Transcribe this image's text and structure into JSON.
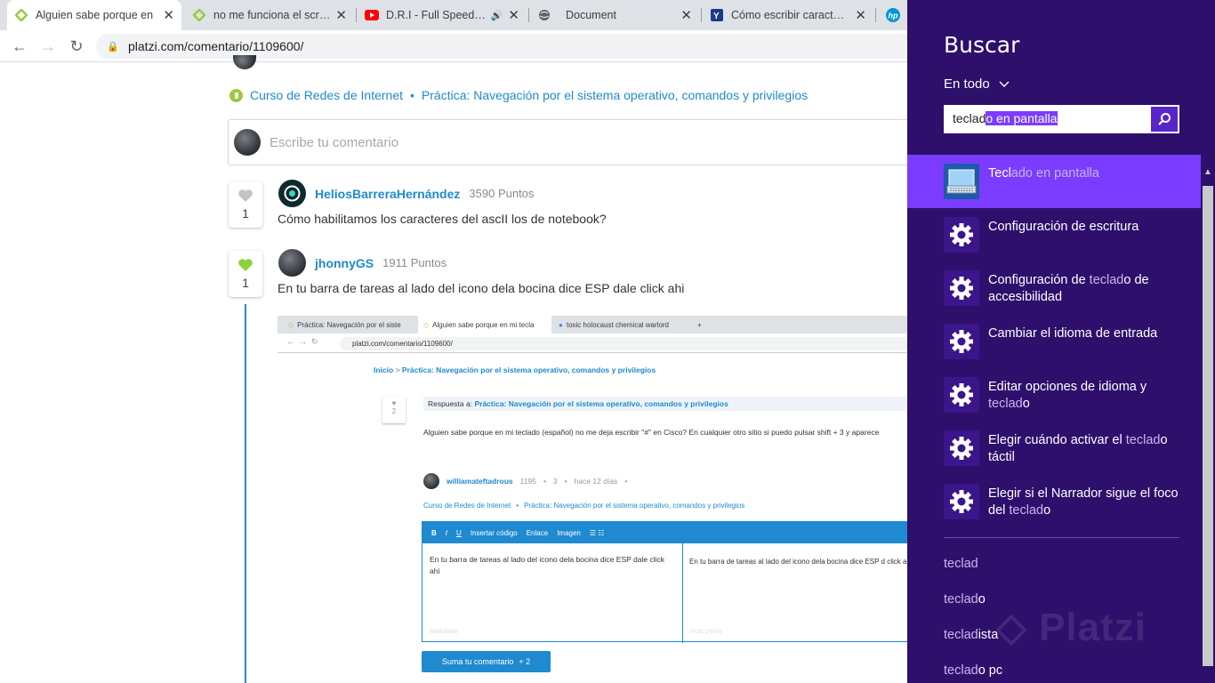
{
  "browser": {
    "tabs": [
      {
        "title": "Alguien sabe porque en",
        "favicon": "platzi"
      },
      {
        "title": "no me funciona el scritp",
        "favicon": "platzi"
      },
      {
        "title": "D.R.I - Full Speed Ah",
        "favicon": "youtube"
      },
      {
        "title": "Document",
        "favicon": "globe"
      },
      {
        "title": "Cómo escribir caracteres",
        "favicon": "yahoo"
      },
      {
        "title": "",
        "favicon": "hp"
      }
    ],
    "url": "platzi.com/comentario/1109600/"
  },
  "page": {
    "breadcrumb": {
      "course": "Curso de Redes de Internet",
      "lesson": "Práctica: Navegación por el sistema operativo, comandos y privilegios"
    },
    "comment_placeholder": "Escribe tu comentario",
    "comments": [
      {
        "user": "HeliosBarreraHernández",
        "points": "3590 Puntos",
        "likes": "1",
        "text": "Cómo habilitamos los caracteres del ascII los de notebook?"
      },
      {
        "user": "jhonnyGS",
        "points": "1911 Puntos",
        "likes": "1",
        "text": "En tu barra de tareas al lado del icono dela bocina dice ESP dale click ahi"
      }
    ],
    "embedded": {
      "tabs": [
        "Práctica: Navegación por el siste",
        "Alguien sabe porque en mi tecla",
        "toxic holocaust chemical warlord"
      ],
      "url": "platzi.com/comentario/1109600/",
      "crumb_home": "Inicio",
      "crumb_lesson": "Práctica: Navegación por el sistema operativo, comandos y privilegios",
      "reply_label": "Respuesta a:",
      "reply_target": "Práctica: Navegación por el sistema operativo, comandos y privilegios",
      "likes": "2",
      "question": "Alguien sabe porque en mi teclado (español) no me deja escribir \"#\" en Cisco? En cualquier otro sitio si puedo pulsar shift + 3 y aparece",
      "author": "williamateftadrous",
      "author_points": "1195",
      "replies": "3",
      "time": "hace 12 días",
      "course": "Curso de Redes de Internet",
      "toolbar": [
        "B",
        "I",
        "U",
        "Insertar código",
        "Enlace",
        "Imagen"
      ],
      "editor_text": "En tu barra de tareas al lado del icono dela bocina dice ESP dale click ahi",
      "preview_text": "En tu barra de tareas al lado del icono dela bocina dice ESP d click ahi",
      "editor_footer_left": "Markdown",
      "editor_footer_right": "Vista previa",
      "send_label": "Suma tu comentario",
      "send_points": "+ 2"
    }
  },
  "charm": {
    "title": "Buscar",
    "scope": "En todo",
    "query_prefix": "teclad",
    "query_selected": "o en pantalla",
    "results": [
      {
        "pre": "Tecl",
        "hit": "ado en pantalla",
        "post": "",
        "icon": "keyboard-icon"
      },
      {
        "pre": "Configuración de escritura",
        "hit": "",
        "post": "",
        "icon": "gear-icon"
      },
      {
        "pre": "Configuración de ",
        "hit": "teclad",
        "post": "o de accesibilidad",
        "icon": "gear-icon"
      },
      {
        "pre": "Cambiar el idioma de entrada",
        "hit": "",
        "post": "",
        "icon": "gear-icon"
      },
      {
        "pre": "Editar opciones de idioma y ",
        "hit": "teclad",
        "post": "o",
        "icon": "gear-icon"
      },
      {
        "pre": "Elegir cuándo activar el ",
        "hit": "teclad",
        "post": "o táctil",
        "icon": "gear-icon"
      },
      {
        "pre": "Elegir si el Narrador sigue el foco del ",
        "hit": "teclad",
        "post": "o",
        "icon": "gear-icon"
      }
    ],
    "suggestions": [
      {
        "hit": "teclad",
        "post": ""
      },
      {
        "hit": "teclad",
        "post": "o"
      },
      {
        "hit": "teclad",
        "post": "ista"
      },
      {
        "hit": "teclad",
        "post": "o pc"
      }
    ],
    "accent": "#2e0f6b",
    "highlight": "#7b3cff",
    "watermark": "Platzi"
  }
}
